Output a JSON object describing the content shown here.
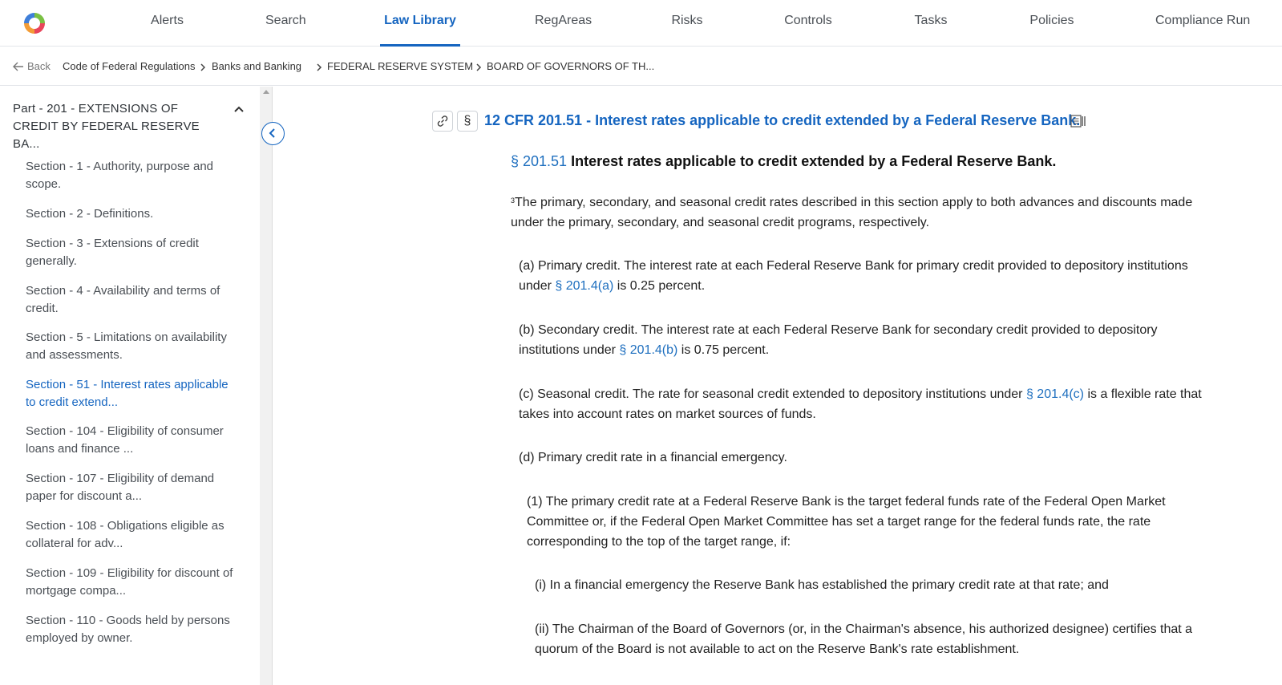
{
  "nav": {
    "items": [
      {
        "label": "Alerts",
        "active": false
      },
      {
        "label": "Search",
        "active": false
      },
      {
        "label": "Law Library",
        "active": true
      },
      {
        "label": "RegAreas",
        "active": false
      },
      {
        "label": "Risks",
        "active": false
      },
      {
        "label": "Controls",
        "active": false
      },
      {
        "label": "Tasks",
        "active": false
      },
      {
        "label": "Policies",
        "active": false
      },
      {
        "label": "Compliance Run",
        "active": false
      }
    ],
    "accent": "#1565c0"
  },
  "breadcrumb": {
    "back_label": "Back",
    "items": [
      "Code of Federal Regulations",
      "Banks and Banking",
      "FEDERAL RESERVE SYSTEM",
      "BOARD OF GOVERNORS OF TH..."
    ]
  },
  "sidebar": {
    "part_title": "Part - 201 - EXTENSIONS OF CREDIT BY FEDERAL RESERVE BA...",
    "toggle_icon": "chevron-up-icon",
    "sections": [
      {
        "label": "Section - 1 - Authority, purpose and scope.",
        "active": false
      },
      {
        "label": "Section - 2 - Definitions.",
        "active": false
      },
      {
        "label": "Section - 3 - Extensions of credit generally.",
        "active": false
      },
      {
        "label": "Section - 4 - Availability and terms of credit.",
        "active": false
      },
      {
        "label": "Section - 5 - Limitations on availability and assessments.",
        "active": false
      },
      {
        "label": "Section - 51 - Interest rates applicable to credit extend...",
        "active": true
      },
      {
        "label": "Section - 104 - Eligibility of consumer loans and finance ...",
        "active": false
      },
      {
        "label": "Section - 107 - Eligibility of demand paper for discount a...",
        "active": false
      },
      {
        "label": "Section - 108 - Obligations eligible as collateral for adv...",
        "active": false
      },
      {
        "label": "Section - 109 - Eligibility for discount of mortgage compa...",
        "active": false
      },
      {
        "label": "Section - 110 - Goods held by persons employed by owner.",
        "active": false
      }
    ]
  },
  "document": {
    "section_symbol": "§",
    "title": "12 CFR 201.51 - Interest rates applicable to credit extended by a Federal Reserve Bank.",
    "heading_number": "§ 201.51",
    "heading_text": "Interest rates applicable to credit extended by a Federal Reserve Bank.",
    "intro_sup": "3",
    "intro": "The primary, secondary, and seasonal credit rates described in this section apply to both advances and discounts made under the primary, secondary, and seasonal credit programs, respectively.",
    "para_a_pre": "(a) Primary credit. The interest rate at each Federal Reserve Bank for primary credit provided to depository institutions under ",
    "para_a_ref": "§ 201.4(a)",
    "para_a_post": " is 0.25 percent.",
    "para_b_pre": "(b) Secondary credit. The interest rate at each Federal Reserve Bank for secondary credit provided to depository institutions under ",
    "para_b_ref": "§ 201.4(b)",
    "para_b_post": " is 0.75 percent.",
    "para_c_pre": "(c) Seasonal credit. The rate for seasonal credit extended to depository institutions under ",
    "para_c_ref": "§ 201.4(c)",
    "para_c_post": " is a flexible rate that takes into account rates on market sources of funds.",
    "para_d": "(d) Primary credit rate in a financial emergency.",
    "para_d1": "(1) The primary credit rate at a Federal Reserve Bank is the target federal funds rate of the Federal Open Market Committee or, if the Federal Open Market Committee has set a target range for the federal funds rate, the rate corresponding to the top of the target range, if:",
    "para_di": "(i) In a financial emergency the Reserve Bank has established the primary credit rate at that rate; and",
    "para_dii": "(ii) The Chairman of the Board of Governors (or, in the Chairman's absence, his authorized designee) certifies that a quorum of the Board is not available to act on the Reserve Bank's rate establishment."
  }
}
